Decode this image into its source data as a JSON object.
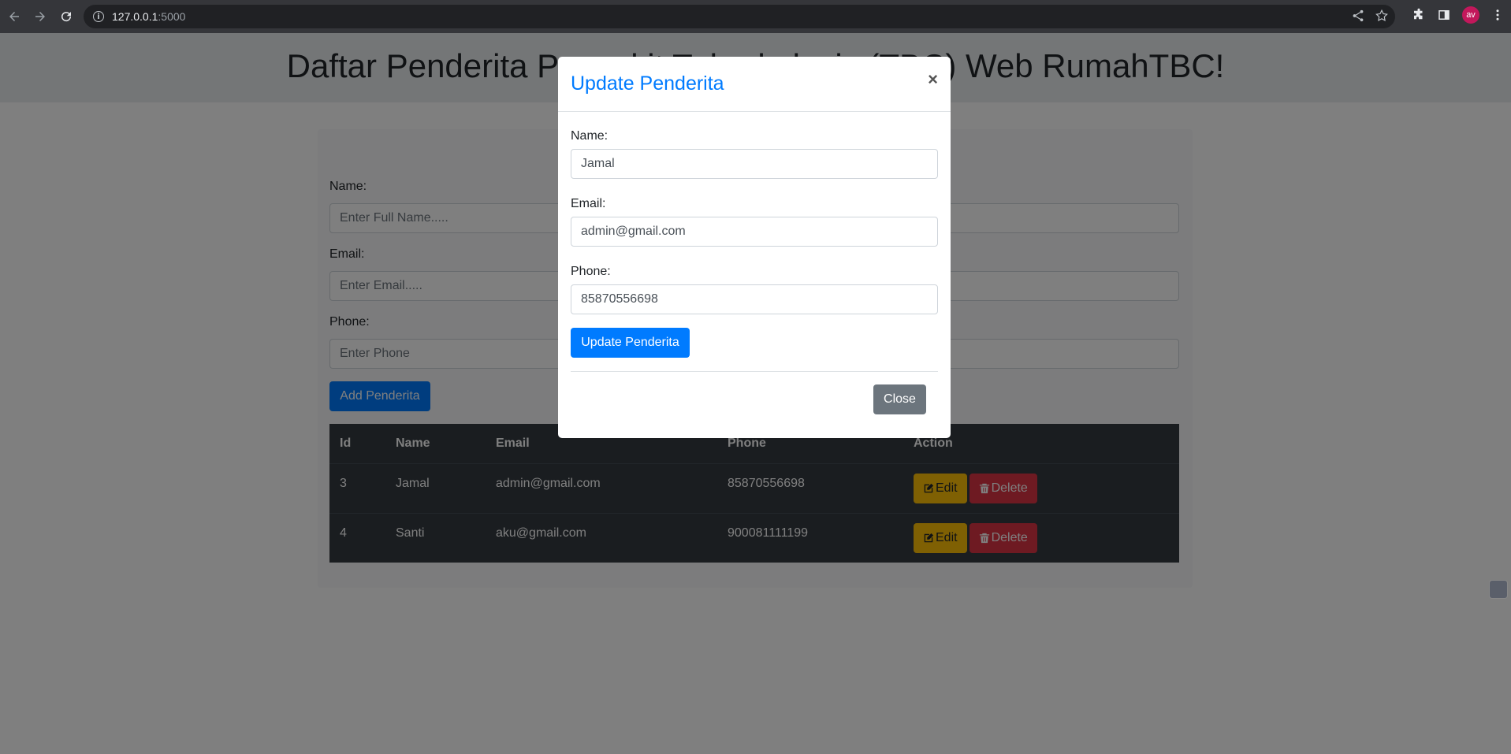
{
  "browser": {
    "url_host": "127.0.0.1",
    "url_port": ":5000",
    "avatar_initials": "av"
  },
  "page": {
    "heading": "Daftar Penderita Penyakit Tuberkulosis (TBC) Web RumahTBC!",
    "form": {
      "name_label": "Name:",
      "name_placeholder": "Enter Full Name.....",
      "email_label": "Email:",
      "email_placeholder": "Enter Email.....",
      "phone_label": "Phone:",
      "phone_placeholder": "Enter Phone",
      "add_button": "Add Penderita"
    },
    "table": {
      "headers": [
        "Id",
        "Name",
        "Email",
        "Phone",
        "Action"
      ],
      "rows": [
        {
          "id": "3",
          "name": "Jamal",
          "email": "admin@gmail.com",
          "phone": "85870556698"
        },
        {
          "id": "4",
          "name": "Santi",
          "email": "aku@gmail.com",
          "phone": "900081111199"
        }
      ],
      "edit_label": "Edit",
      "delete_label": "Delete"
    }
  },
  "modal": {
    "title": "Update Penderita",
    "close_x": "×",
    "name_label": "Name:",
    "name_value": "Jamal",
    "email_label": "Email:",
    "email_value": "admin@gmail.com",
    "phone_label": "Phone:",
    "phone_value": "85870556698",
    "update_button": "Update Penderita",
    "close_button": "Close"
  },
  "colors": {
    "primary": "#007bff",
    "warning": "#ffc107",
    "danger": "#dc3545",
    "secondary": "#6c757d",
    "table_dark": "#343a40"
  }
}
